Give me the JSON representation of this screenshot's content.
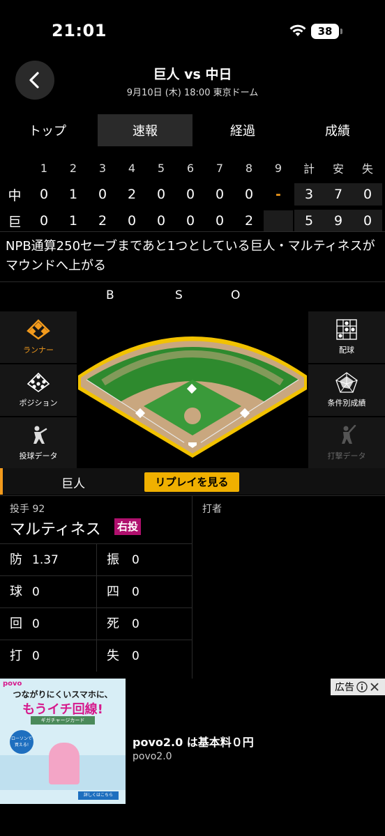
{
  "status_bar": {
    "time": "21:01",
    "battery": "38"
  },
  "header": {
    "title": "巨人 vs 中日",
    "subtitle": "9月10日 (木) 18:00 東京ドーム"
  },
  "tabs": [
    {
      "label": "トップ",
      "active": false
    },
    {
      "label": "速報",
      "active": true
    },
    {
      "label": "経過",
      "active": false
    },
    {
      "label": "成績",
      "active": false
    }
  ],
  "scoreboard": {
    "innings": [
      "1",
      "2",
      "3",
      "4",
      "5",
      "6",
      "7",
      "8",
      "9"
    ],
    "totals_header": [
      "計",
      "安",
      "失"
    ],
    "teams": [
      {
        "abbr": "中",
        "innings": [
          "0",
          "1",
          "0",
          "2",
          "0",
          "0",
          "0",
          "0",
          "-"
        ],
        "totals": [
          "3",
          "7",
          "0"
        ]
      },
      {
        "abbr": "巨",
        "innings": [
          "0",
          "1",
          "2",
          "0",
          "0",
          "0",
          "0",
          "2",
          ""
        ],
        "totals": [
          "5",
          "9",
          "0"
        ]
      }
    ]
  },
  "commentary": "NPB通算250セーブまであと1つとしている巨人・マルティネスがマウンドへ上がる",
  "bso": {
    "b": "B",
    "s": "S",
    "o": "O"
  },
  "side_buttons": {
    "runner": "ランナー",
    "position": "ポジション",
    "pitch_data": "投球データ",
    "pitch_chart": "配球",
    "condition_stats": "条件別成績",
    "batting_data": "打撃データ"
  },
  "team_row": {
    "team": "巨人",
    "replay": "リプレイを見る"
  },
  "pitcher": {
    "label": "投手 92",
    "name": "マルティネス",
    "hand": "右投",
    "stats": [
      {
        "k1": "防",
        "v1": "1.37",
        "k2": "振",
        "v2": "0"
      },
      {
        "k1": "球",
        "v1": "0",
        "k2": "四",
        "v2": "0"
      },
      {
        "k1": "回",
        "v1": "0",
        "k2": "死",
        "v2": "0"
      },
      {
        "k1": "打",
        "v1": "0",
        "k2": "失",
        "v2": "0"
      }
    ]
  },
  "batter": {
    "label": "打者"
  },
  "ad": {
    "tag": "広告",
    "brand": "povo",
    "headline1": "つながりにくいスマホに、",
    "headline2": "もうイチ回線!",
    "card": "ギガチャージカード",
    "lawson": "ローソンで買える!",
    "detail": "詳しくはこちら",
    "title": "povo2.0 は基本料０円",
    "sub": "povo2.0"
  }
}
